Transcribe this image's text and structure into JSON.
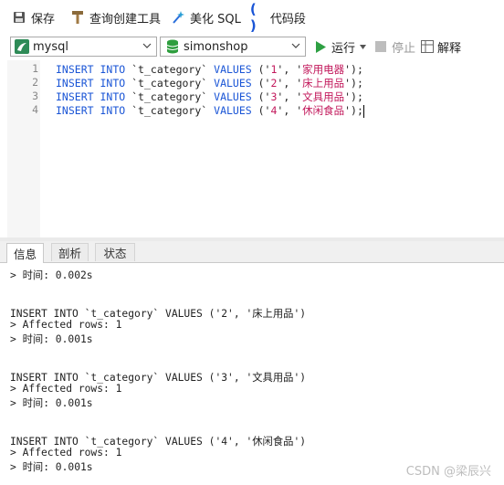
{
  "toolbar": {
    "save": "保存",
    "query_builder": "查询创建工具",
    "beautify_sql": "美化 SQL",
    "code_snippet": "代码段"
  },
  "connection": {
    "server": "mysql",
    "database": "simonshop",
    "run": "运行",
    "stop": "停止",
    "explain": "解释"
  },
  "editor": {
    "line_numbers": [
      "1",
      "2",
      "3",
      "4"
    ],
    "lines": [
      {
        "kw1": "INSERT",
        "kw2": "INTO",
        "table": "`t_category`",
        "kw3": "VALUES",
        "open": " ('",
        "id": "1",
        "mid": "', '",
        "name": "家用电器",
        "close": "');"
      },
      {
        "kw1": "INSERT",
        "kw2": "INTO",
        "table": "`t_category`",
        "kw3": "VALUES",
        "open": " ('",
        "id": "2",
        "mid": "', '",
        "name": "床上用品",
        "close": "');"
      },
      {
        "kw1": "INSERT",
        "kw2": "INTO",
        "table": "`t_category`",
        "kw3": "VALUES",
        "open": " ('",
        "id": "3",
        "mid": "', '",
        "name": "文具用品",
        "close": "');"
      },
      {
        "kw1": "INSERT",
        "kw2": "INTO",
        "table": "`t_category`",
        "kw3": "VALUES",
        "open": " ('",
        "id": "4",
        "mid": "', '",
        "name": "休闲食品",
        "close": "');"
      }
    ]
  },
  "tabs": [
    "信息",
    "剖析",
    "状态"
  ],
  "output": {
    "lines": [
      "> 时间: 0.002s",
      "",
      "",
      "INSERT INTO `t_category` VALUES ('2', '床上用品')",
      "> Affected rows: 1",
      "> 时间: 0.001s",
      "",
      "",
      "INSERT INTO `t_category` VALUES ('3', '文具用品')",
      "> Affected rows: 1",
      "> 时间: 0.001s",
      "",
      "",
      "INSERT INTO `t_category` VALUES ('4', '休闲食品')",
      "> Affected rows: 1",
      "> 时间: 0.001s"
    ]
  },
  "watermark": "CSDN @梁辰兴",
  "icons": {
    "save": "floppy-disk-icon",
    "query_builder": "hammer-icon",
    "beautify": "magic-wand-icon",
    "code_snippet": "parentheses-icon",
    "server": "mysql-dolphin-icon",
    "database": "database-cylinder-icon",
    "run": "play-icon",
    "stop": "stop-square-icon",
    "explain": "explain-grid-icon"
  },
  "colors": {
    "keyword": "#1a55d6",
    "string": "#c2185b",
    "run_green": "#2ea043",
    "database_green": "#2e9e3e"
  }
}
